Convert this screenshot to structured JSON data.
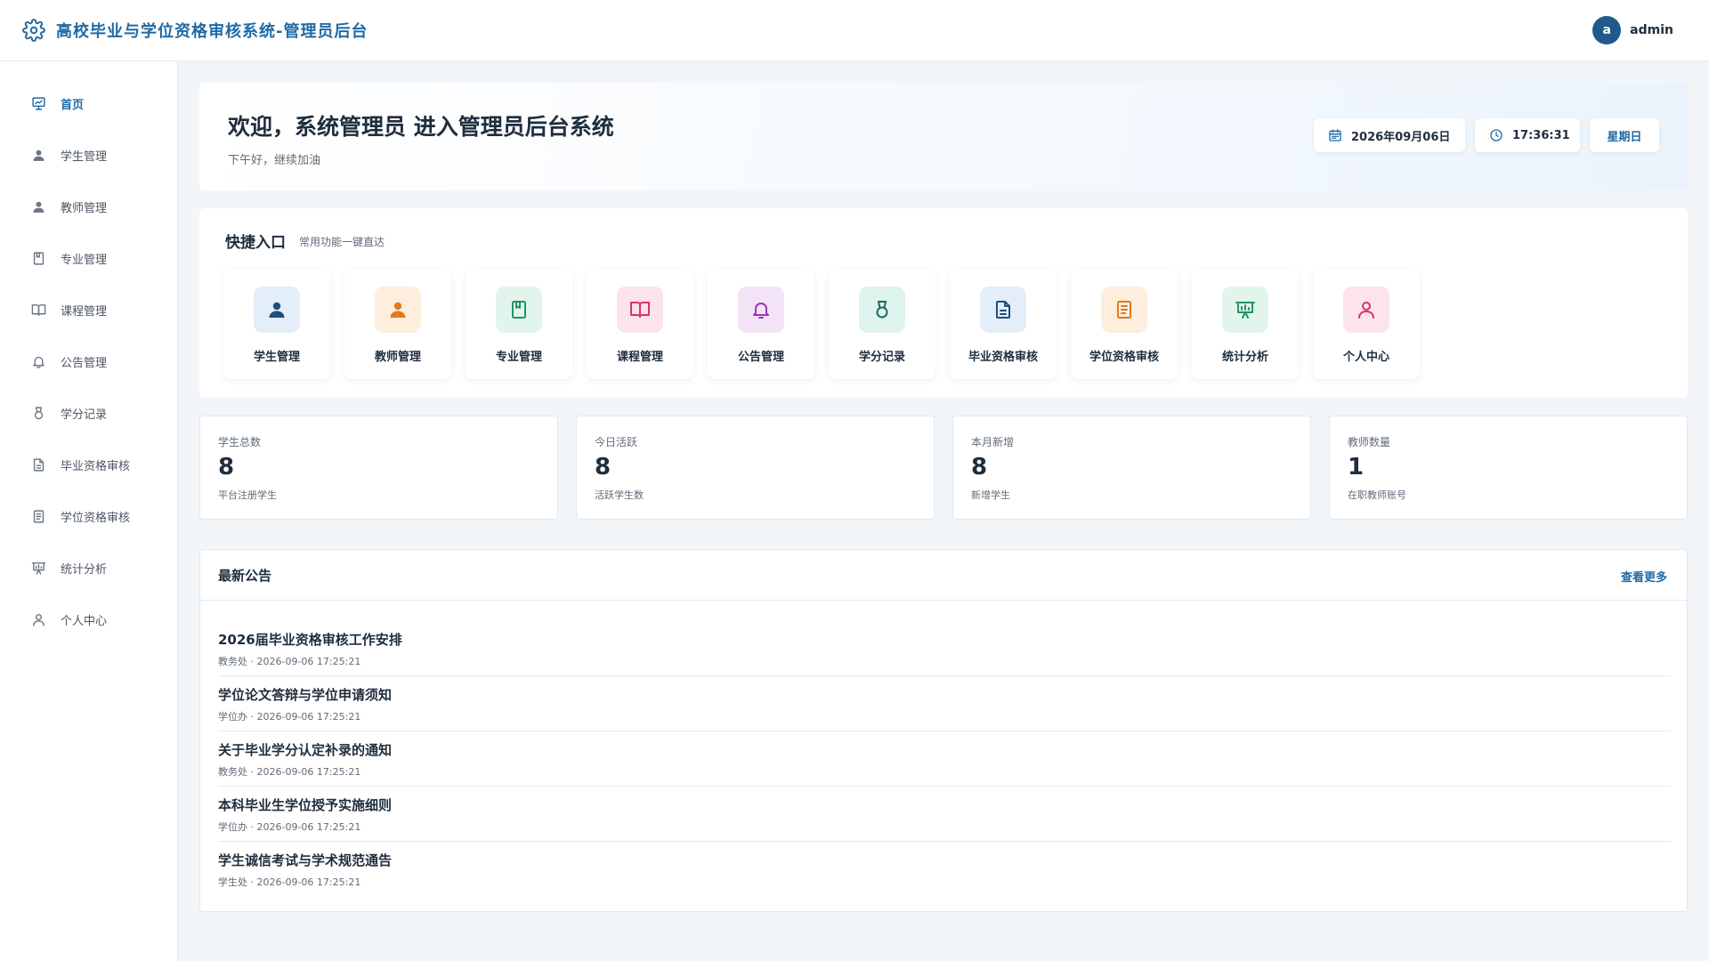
{
  "header": {
    "title": "高校毕业与学位资格审核系统-管理员后台",
    "avatar_letter": "a",
    "username": "admin"
  },
  "sidebar": {
    "items": [
      {
        "label": "首页",
        "icon": "presentation-icon",
        "active": true
      },
      {
        "label": "学生管理",
        "icon": "user-icon"
      },
      {
        "label": "教师管理",
        "icon": "user-icon"
      },
      {
        "label": "专业管理",
        "icon": "book-icon"
      },
      {
        "label": "课程管理",
        "icon": "open-book-icon"
      },
      {
        "label": "公告管理",
        "icon": "bell-icon"
      },
      {
        "label": "学分记录",
        "icon": "medal-icon"
      },
      {
        "label": "毕业资格审核",
        "icon": "document-icon"
      },
      {
        "label": "学位资格审核",
        "icon": "list-document-icon"
      },
      {
        "label": "统计分析",
        "icon": "chart-board-icon"
      },
      {
        "label": "个人中心",
        "icon": "user-outline-icon"
      }
    ]
  },
  "welcome": {
    "title": "欢迎，系统管理员 进入管理员后台系统",
    "subtitle": "下午好，继续加油",
    "date": "2026年09月06日",
    "time": "17:36:31",
    "weekday": "星期日"
  },
  "quick": {
    "title": "快捷入口",
    "subtitle": "常用功能一键直达",
    "items": [
      {
        "label": "学生管理",
        "icon": "user-icon",
        "bg": "#e3eef9",
        "fg": "#1f4e79"
      },
      {
        "label": "教师管理",
        "icon": "user-icon",
        "bg": "#fdeedd",
        "fg": "#e07b1f"
      },
      {
        "label": "专业管理",
        "icon": "book-icon",
        "bg": "#e1f5ec",
        "fg": "#22955f"
      },
      {
        "label": "课程管理",
        "icon": "open-book-icon",
        "bg": "#fce3ec",
        "fg": "#d6336c"
      },
      {
        "label": "公告管理",
        "icon": "bell-icon",
        "bg": "#f3e3f6",
        "fg": "#9c36b5"
      },
      {
        "label": "学分记录",
        "icon": "medal-icon",
        "bg": "#dff3ef",
        "fg": "#1d6b5c"
      },
      {
        "label": "毕业资格审核",
        "icon": "document-icon",
        "bg": "#e3eef9",
        "fg": "#1f4e79"
      },
      {
        "label": "学位资格审核",
        "icon": "list-document-icon",
        "bg": "#fdeedd",
        "fg": "#e07b1f"
      },
      {
        "label": "统计分析",
        "icon": "chart-board-icon",
        "bg": "#e1f5ec",
        "fg": "#22955f"
      },
      {
        "label": "个人中心",
        "icon": "user-outline-icon",
        "bg": "#fce3ec",
        "fg": "#d6336c"
      }
    ]
  },
  "stats": [
    {
      "label": "学生总数",
      "value": "8",
      "note": "平台注册学生"
    },
    {
      "label": "今日活跃",
      "value": "8",
      "note": "活跃学生数"
    },
    {
      "label": "本月新增",
      "value": "8",
      "note": "新增学生"
    },
    {
      "label": "教师数量",
      "value": "1",
      "note": "在职教师账号"
    }
  ],
  "notices": {
    "title": "最新公告",
    "more_label": "查看更多",
    "items": [
      {
        "title": "2026届毕业资格审核工作安排",
        "meta": "教务处 · 2026-09-06 17:25:21"
      },
      {
        "title": "学位论文答辩与学位申请须知",
        "meta": "学位办 · 2026-09-06 17:25:21"
      },
      {
        "title": "关于毕业学分认定补录的通知",
        "meta": "教务处 · 2026-09-06 17:25:21"
      },
      {
        "title": "本科毕业生学位授予实施细则",
        "meta": "学位办 · 2026-09-06 17:25:21"
      },
      {
        "title": "学生诚信考试与学术规范通告",
        "meta": "学生处 · 2026-09-06 17:25:21"
      }
    ]
  },
  "colors": {
    "primary": "#1f6aa5",
    "text": "#1f2d3d",
    "muted": "#606b78",
    "background": "#f3f6f9"
  }
}
